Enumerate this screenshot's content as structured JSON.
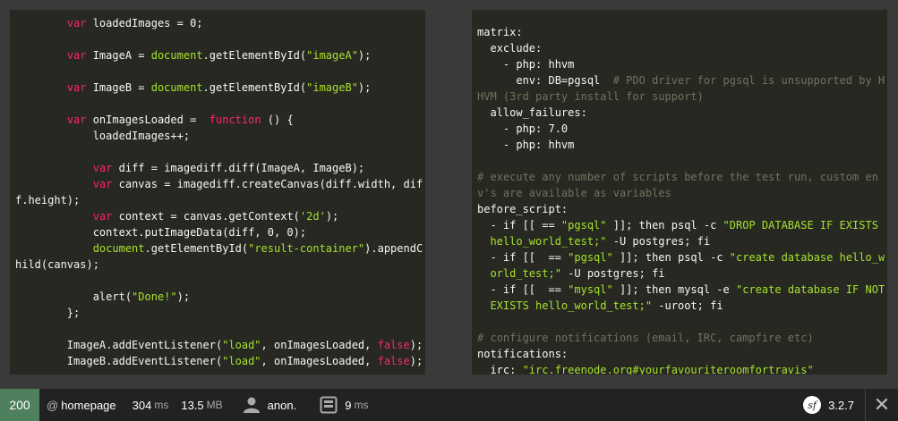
{
  "left_code": {
    "lines": [
      [
        [
          "t",
          "        "
        ],
        [
          "kw",
          "var"
        ],
        [
          "t",
          " loadedImages = 0;"
        ]
      ],
      [],
      [
        [
          "t",
          "        "
        ],
        [
          "kw",
          "var"
        ],
        [
          "t",
          " ImageA = "
        ],
        [
          "str",
          "document"
        ],
        [
          "t",
          ".getElementById("
        ],
        [
          "str",
          "\"imageA\""
        ],
        [
          "t",
          ");"
        ]
      ],
      [],
      [
        [
          "t",
          "        "
        ],
        [
          "kw",
          "var"
        ],
        [
          "t",
          " ImageB = "
        ],
        [
          "str",
          "document"
        ],
        [
          "t",
          ".getElementById("
        ],
        [
          "str",
          "\"imageB\""
        ],
        [
          "t",
          ");"
        ]
      ],
      [],
      [
        [
          "t",
          "        "
        ],
        [
          "kw",
          "var"
        ],
        [
          "t",
          " onImagesLoaded =  "
        ],
        [
          "kw",
          "function"
        ],
        [
          "t",
          " () {"
        ]
      ],
      [
        [
          "t",
          "            loadedImages++;"
        ]
      ],
      [],
      [
        [
          "t",
          "            "
        ],
        [
          "kw",
          "var"
        ],
        [
          "t",
          " diff = imagediff.diff(ImageA, ImageB);"
        ]
      ],
      [
        [
          "t",
          "            "
        ],
        [
          "kw",
          "var"
        ],
        [
          "t",
          " canvas = imagediff.createCanvas(diff.width, dif"
        ]
      ],
      [
        [
          "t",
          "f.height);"
        ]
      ],
      [
        [
          "t",
          "            "
        ],
        [
          "kw",
          "var"
        ],
        [
          "t",
          " context = canvas.getContext("
        ],
        [
          "str",
          "'2d'"
        ],
        [
          "t",
          ");"
        ]
      ],
      [
        [
          "t",
          "            context.putImageData(diff, 0, 0);"
        ]
      ],
      [
        [
          "t",
          "            "
        ],
        [
          "str",
          "document"
        ],
        [
          "t",
          ".getElementById("
        ],
        [
          "str",
          "\"result-container\""
        ],
        [
          "t",
          ").appendC"
        ]
      ],
      [
        [
          "t",
          "hild(canvas);"
        ]
      ],
      [],
      [
        [
          "t",
          "            alert("
        ],
        [
          "str",
          "\"Done!\""
        ],
        [
          "t",
          ");"
        ]
      ],
      [
        [
          "t",
          "        };"
        ]
      ],
      [],
      [
        [
          "t",
          "        ImageA.addEventListener("
        ],
        [
          "str",
          "\"load\""
        ],
        [
          "t",
          ", onImagesLoaded, "
        ],
        [
          "kw",
          "false"
        ],
        [
          "t",
          ");"
        ]
      ],
      [
        [
          "t",
          "        ImageB.addEventListener("
        ],
        [
          "str",
          "\"load\""
        ],
        [
          "t",
          ", onImagesLoaded, "
        ],
        [
          "kw",
          "false"
        ],
        [
          "t",
          ");"
        ]
      ]
    ]
  },
  "right_code": {
    "lines": [
      [
        [
          "t",
          "matrix:"
        ]
      ],
      [
        [
          "t",
          "  exclude:"
        ]
      ],
      [
        [
          "t",
          "    - php: hhvm"
        ]
      ],
      [
        [
          "t",
          "      env: DB=pgsql  "
        ],
        [
          "cm",
          "# PDO driver for pgsql is unsupported by H"
        ]
      ],
      [
        [
          "cm",
          "HVM (3rd party install for support)"
        ]
      ],
      [
        [
          "t",
          "  allow_failures:"
        ]
      ],
      [
        [
          "t",
          "    - php: 7.0"
        ]
      ],
      [
        [
          "t",
          "    - php: hhvm"
        ]
      ],
      [],
      [
        [
          "cm",
          "# execute any number of scripts before the test run, custom en"
        ]
      ],
      [
        [
          "cm",
          "v's are available as variables"
        ]
      ],
      [
        [
          "t",
          "before_script:"
        ]
      ],
      [
        [
          "t",
          "  - if [[ == "
        ],
        [
          "str",
          "\"pgsql\""
        ],
        [
          "t",
          " ]]; then psql -c "
        ],
        [
          "str",
          "\"DROP DATABASE IF EXISTS"
        ]
      ],
      [
        [
          "str",
          "  hello_world_test;\""
        ],
        [
          "t",
          " -U postgres; fi"
        ]
      ],
      [
        [
          "t",
          "  - if [[  == "
        ],
        [
          "str",
          "\"pgsql\""
        ],
        [
          "t",
          " ]]; then psql -c "
        ],
        [
          "str",
          "\"create database hello_w"
        ]
      ],
      [
        [
          "str",
          "  orld_test;\""
        ],
        [
          "t",
          " -U postgres; fi"
        ]
      ],
      [
        [
          "t",
          "  - if [[  == "
        ],
        [
          "str",
          "\"mysql\""
        ],
        [
          "t",
          " ]]; then mysql -e "
        ],
        [
          "str",
          "\"create database IF NOT"
        ]
      ],
      [
        [
          "str",
          "  EXISTS hello_world_test;\""
        ],
        [
          "t",
          " -uroot; fi"
        ]
      ],
      [],
      [
        [
          "cm",
          "# configure notifications (email, IRC, campfire etc)"
        ]
      ],
      [
        [
          "t",
          "notifications:"
        ]
      ],
      [
        [
          "t",
          "  irc: "
        ],
        [
          "str",
          "\"irc.freenode.org#yourfavouriteroomfortravis\""
        ]
      ]
    ]
  },
  "toolbar": {
    "status_code": "200",
    "route_prefix": "@",
    "route": "homepage",
    "time_value": "304",
    "time_unit": "ms",
    "memory_value": "13.5",
    "memory_unit": "MB",
    "user_icon": "user-icon",
    "user": "anon.",
    "db_icon": "database-icon",
    "db_time_value": "9",
    "db_time_unit": "ms",
    "symfony_icon": "symfony-logo-icon",
    "version": "3.2.7",
    "close_icon": "close-icon",
    "close_label": "✕",
    "status_color": "#4f805d"
  }
}
